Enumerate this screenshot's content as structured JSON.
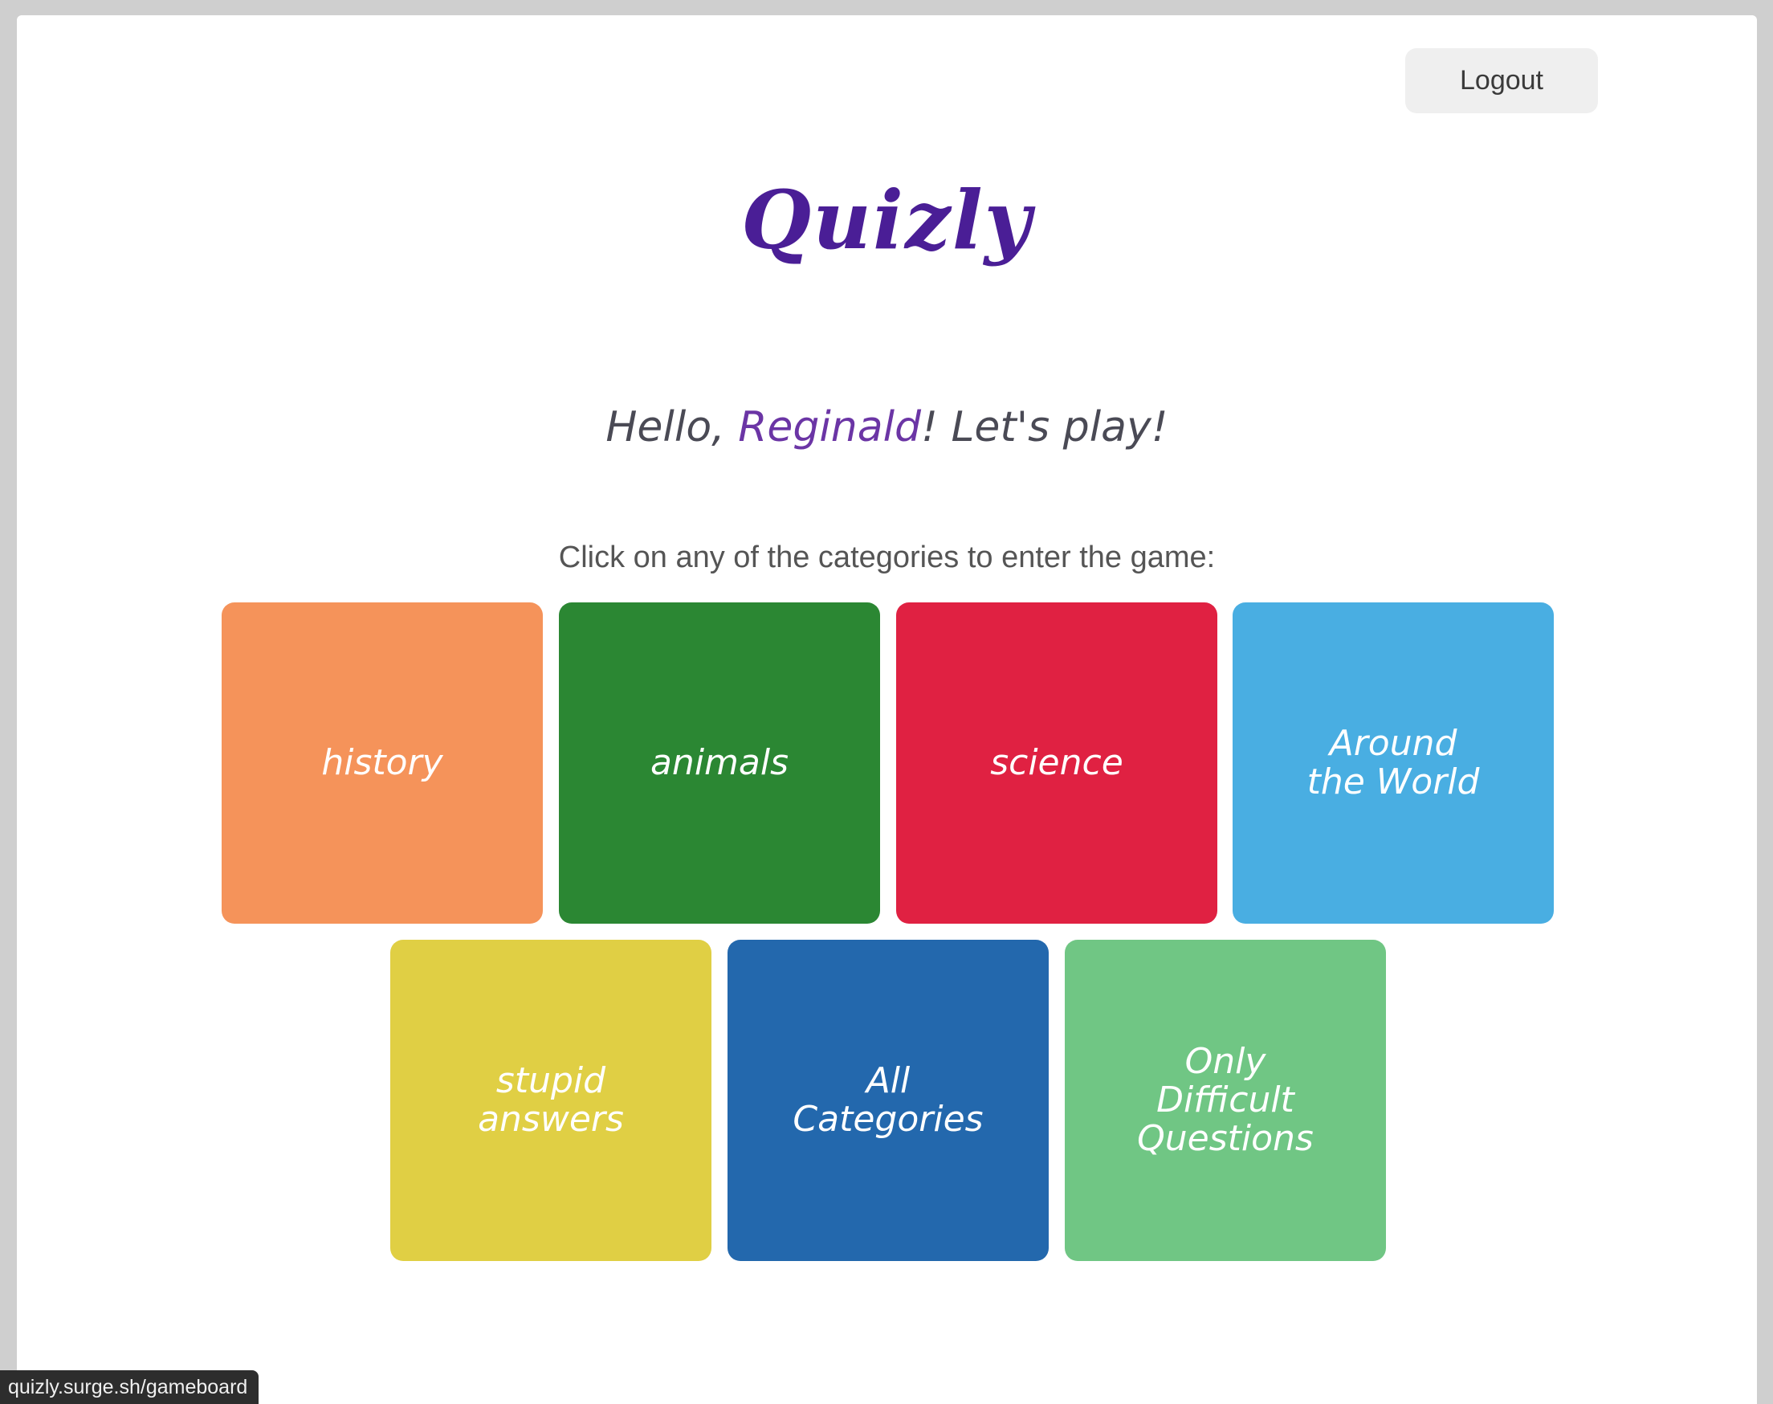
{
  "header": {
    "logout_label": "Logout"
  },
  "logo": {
    "text": "Quizly"
  },
  "greeting": {
    "prefix": "Hello, ",
    "username": "Reginald",
    "suffix": "! Let's play!"
  },
  "instruction": "Click on any of the categories to enter the game:",
  "categories": [
    {
      "label": "history",
      "color": "#f5935a"
    },
    {
      "label": "animals",
      "color": "#2b8733"
    },
    {
      "label": "science",
      "color": "#e02142"
    },
    {
      "label": "Around\nthe World",
      "color": "#49aee2"
    },
    {
      "label": "stupid\nanswers",
      "color": "#e0cf44"
    },
    {
      "label": "All\nCategories",
      "color": "#2368ad"
    },
    {
      "label": "Only\nDifficult\nQuestions",
      "color": "#70c684"
    }
  ],
  "status_bar": {
    "url": "quizly.surge.sh/gameboard"
  },
  "colors": {
    "brand": "#4a1e96",
    "username": "#6b35a5"
  }
}
